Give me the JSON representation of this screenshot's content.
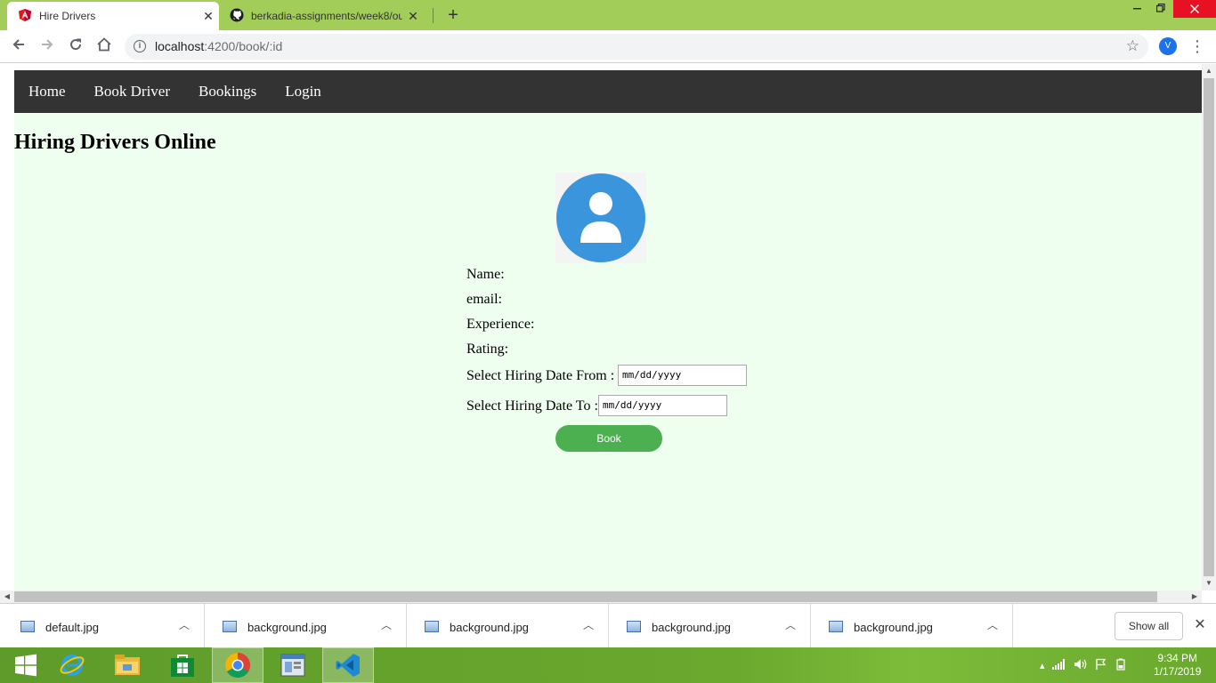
{
  "browser": {
    "tabs": [
      {
        "title": "Hire Drivers",
        "close": "✕"
      },
      {
        "title": "berkadia-assignments/week8/ou",
        "close": "✕"
      }
    ],
    "new_tab": "+",
    "url_host": "localhost",
    "url_path": ":4200/book/:id",
    "profile_initial": "V"
  },
  "page": {
    "nav": [
      "Home",
      "Book Driver",
      "Bookings",
      "Login"
    ],
    "title": "Hiring Drivers Online",
    "form": {
      "name_label": "Name:",
      "email_label": "email:",
      "experience_label": "Experience:",
      "rating_label": "Rating:",
      "date_from_label": "Select Hiring Date From :",
      "date_to_label": "Select Hiring Date To :",
      "date_placeholder": "mm/dd/yyyy",
      "book_button": "Book"
    }
  },
  "downloads": {
    "items": [
      "default.jpg",
      "background.jpg",
      "background.jpg",
      "background.jpg",
      "background.jpg"
    ],
    "show_all": "Show all"
  },
  "taskbar": {
    "time": "9:34 PM",
    "date": "1/17/2019"
  },
  "colors": {
    "tab_bar": "#a2cd59",
    "nav_bg": "#333333",
    "page_bg": "#efffef",
    "book_button": "#4caf50",
    "avatar": "#3a95dc"
  }
}
